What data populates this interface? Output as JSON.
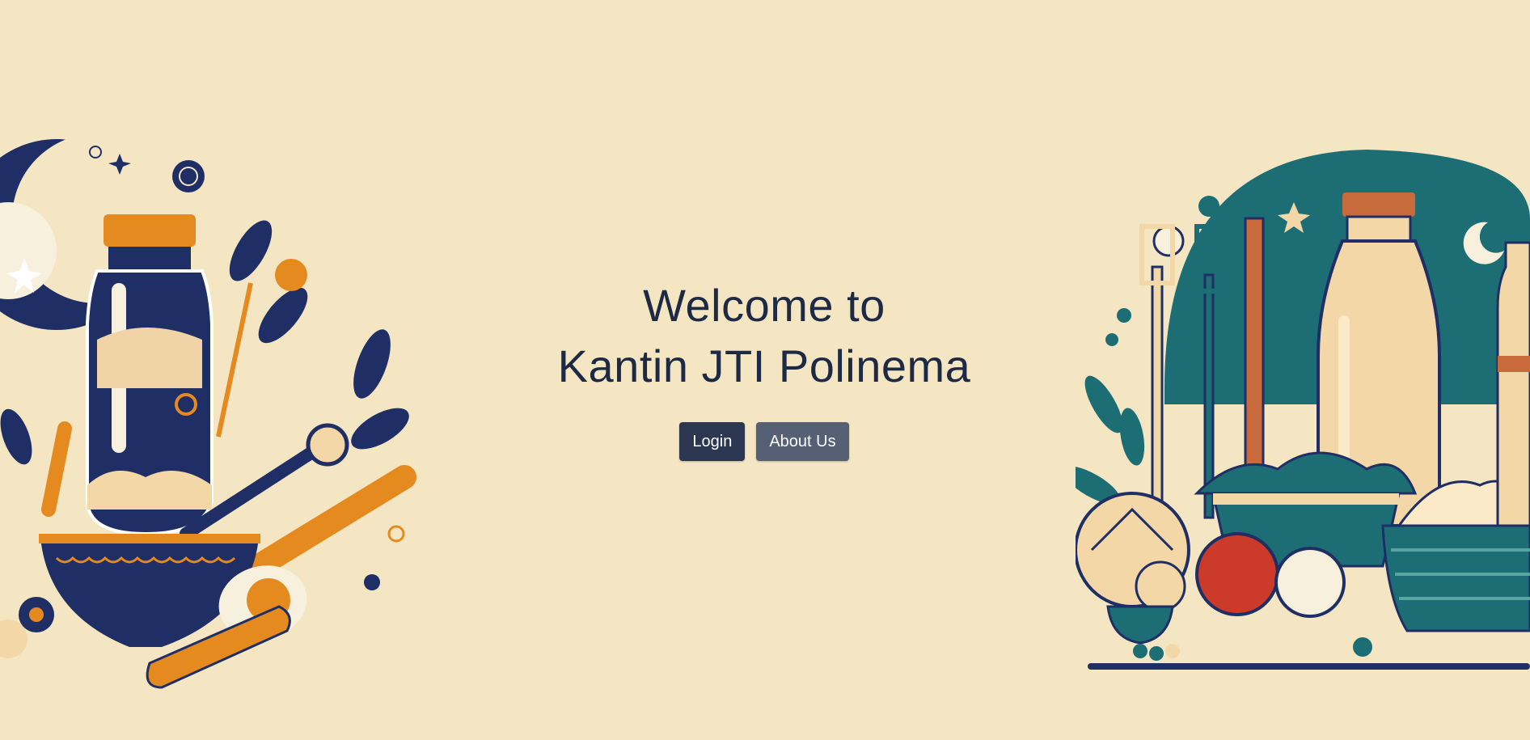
{
  "hero": {
    "line1": "Welcome to",
    "line2": "Kantin JTI Polinema"
  },
  "actions": {
    "login_label": "Login",
    "about_label": "About Us"
  },
  "colors": {
    "background": "#f5e6c3",
    "heading": "#1e2a44",
    "login_button": "#2b3650",
    "about_button": "#566075",
    "navy": "#1f2f66",
    "orange": "#e58a1f",
    "teal": "#1d6e74",
    "cream": "#f4d7a6",
    "red": "#cc3b2a"
  },
  "images": {
    "left": "food-illustration-left",
    "right": "food-illustration-right"
  }
}
